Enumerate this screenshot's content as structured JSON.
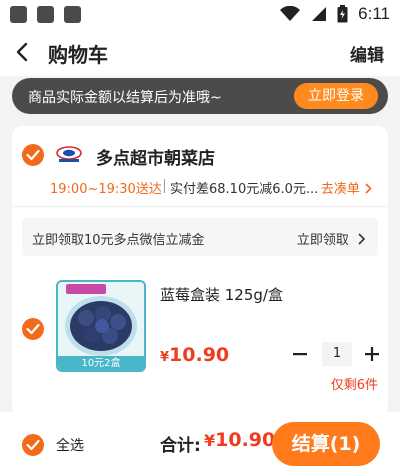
{
  "status_bar": {
    "time": "6:11"
  },
  "header": {
    "title": "购物车",
    "edit_label": "编辑"
  },
  "login_banner": {
    "text": "商品实际金额以结算后为准哦~",
    "button_label": "立即登录"
  },
  "store": {
    "name": "多点超市朝菜店",
    "delivery_time": "19:00~19:30送达",
    "delivery_note": "实付差68.10元减6.0元...",
    "add_on_label": "去凑单",
    "coupon_text": "立即领取10元多点微信立减金",
    "coupon_claim_label": "立即领取"
  },
  "product": {
    "name": "蓝莓盒装 125g/盒",
    "currency": "¥",
    "price": "10.90",
    "quantity": "1",
    "stock_note": "仅剩6件",
    "image_caption": "10元2盒"
  },
  "bottom_bar": {
    "select_all_label": "全选",
    "total_label": "合计:",
    "currency": "¥",
    "total_amount": "10.90",
    "checkout_label": "结算(1)"
  },
  "colors": {
    "accent": "#f26a1b",
    "price": "#f03c1e",
    "banner_bg": "#4b4b4b"
  },
  "icons": [
    "wifi-icon",
    "signal-icon",
    "battery-icon",
    "back-icon",
    "chevron-right-icon",
    "check-icon",
    "minus-icon",
    "plus-icon",
    "store-logo-icon"
  ]
}
